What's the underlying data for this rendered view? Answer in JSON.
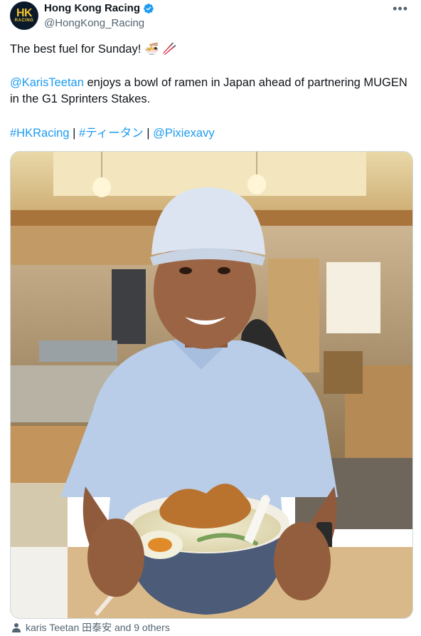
{
  "account": {
    "display_name": "Hong Kong Racing",
    "handle": "@HongKong_Racing",
    "avatar_text_main": "HK",
    "avatar_text_sub": "RACING",
    "verified_icon": "verified-badge-icon",
    "more_label": "•••"
  },
  "tweet": {
    "line1": "The best fuel for Sunday!",
    "line1_emoji": "🍜 🥢",
    "mention": "@KarisTeetan",
    "line2_rest": " enjoys a bowl of ramen in Japan ahead of partnering MUGEN in the G1 Sprinters Stakes.",
    "hashtag1": "#HKRacing",
    "separator": "|",
    "hashtag2": "#ティータン",
    "mention2": "@Pixiexavy"
  },
  "photo": {
    "icon": "ramen-photo"
  },
  "tagged": {
    "icon": "person-icon",
    "text": "karis Teetan 田泰安 and 9 others"
  },
  "colors": {
    "link": "#1d9bf0",
    "text": "#0f1419",
    "muted": "#536471"
  }
}
